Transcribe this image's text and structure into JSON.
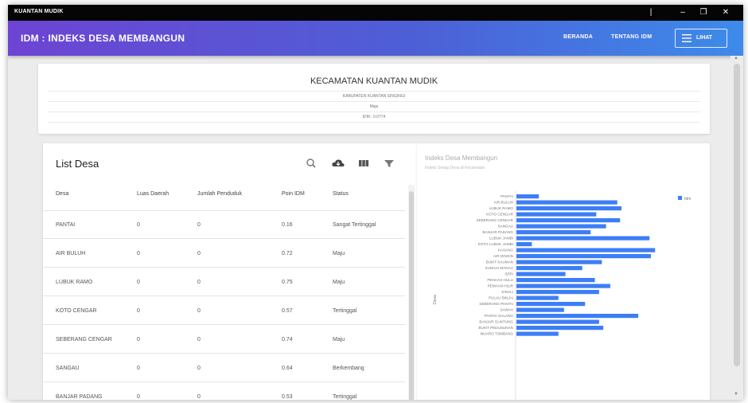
{
  "window": {
    "title": "KUANTAN MUDIK"
  },
  "appbar": {
    "title": "IDM : INDEKS DESA MEMBANGUN",
    "nav": [
      "BERANDA",
      "TENTANG IDM"
    ],
    "menu_label": "LIHAT"
  },
  "header": {
    "kecamatan": "KECAMATAN KUANTAN MUDIK",
    "kabupaten": "KABUPATEN KUANTAN SINGINGI",
    "status": "Maju",
    "idm": "IDM : 0.0774"
  },
  "list": {
    "title": "List Desa",
    "columns": [
      "Desa",
      "Luas Daerah",
      "Jumlah Penduduk",
      "Poin IDM",
      "Status"
    ],
    "rows": [
      [
        "PANTAI",
        "0",
        "0",
        "0.16",
        "Sangat Tertinggal"
      ],
      [
        "AIR BULUH",
        "0",
        "0",
        "0.72",
        "Maju"
      ],
      [
        "LUBUK RAMO",
        "0",
        "0",
        "0.75",
        "Maju"
      ],
      [
        "KOTO CENGAR",
        "0",
        "0",
        "0.57",
        "Tertinggal"
      ],
      [
        "SEBERANG CENGAR",
        "0",
        "0",
        "0.74",
        "Maju"
      ],
      [
        "SANGAU",
        "0",
        "0",
        "0.64",
        "Berkembang"
      ],
      [
        "BANJAR PADANG",
        "0",
        "0",
        "0.53",
        "Tertinggal"
      ]
    ]
  },
  "colors": {
    "bar": "#3d7ef5",
    "appbar_start": "#6d44d3",
    "appbar_end": "#3d8bea"
  },
  "chart_data": {
    "type": "bar",
    "orientation": "horizontal",
    "title": "Indeks Desa Membangun",
    "subtitle": "Indeks Setiap Desa di Kecamatan",
    "ylabel": "Desa",
    "legend": {
      "label": "Idm",
      "position": "top-right"
    },
    "categories": [
      "PANTAI",
      "AIR BULUH",
      "LUBUK RAMO",
      "KOTO CENGAR",
      "SEBERANG CENGAR",
      "SANGAU",
      "BANJAR PADANG",
      "LUBUK JAMBI",
      "KOTO LUBUK JAMBI",
      "KASANG",
      "AIR DINGIN",
      "BUKIT KAUMAN",
      "SUNGAI MANAU",
      "SERI",
      "PENAAH HULU",
      "PEMAAN HILIR",
      "KINALI",
      "PULAU BINJAI",
      "SEBERANG PANTAI",
      "SAWAH",
      "PANTAI GALANG",
      "BANJAR GUNTUNG",
      "BUKIT PEDUSUNAN",
      "MUARO TOMBANG"
    ],
    "values": [
      0.16,
      0.72,
      0.75,
      0.57,
      0.74,
      0.64,
      0.53,
      0.95,
      0.11,
      0.99,
      0.96,
      0.61,
      0.47,
      0.35,
      0.56,
      0.67,
      0.59,
      0.3,
      0.49,
      0.34,
      0.87,
      0.59,
      0.62,
      0.3
    ]
  }
}
